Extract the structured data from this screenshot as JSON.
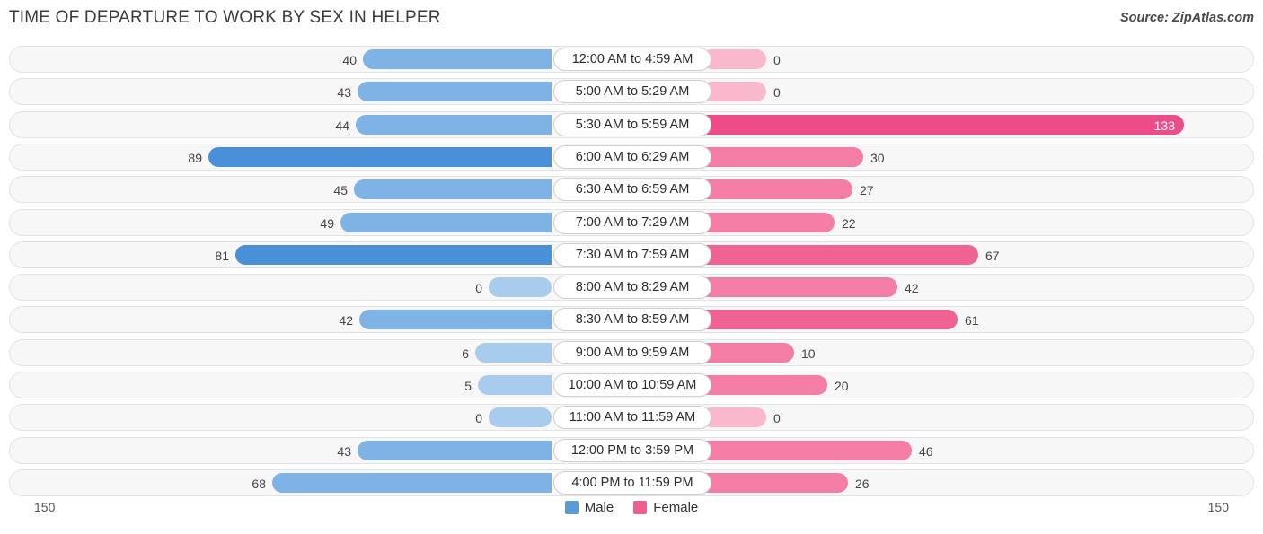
{
  "header": {
    "title": "TIME OF DEPARTURE TO WORK BY SEX IN HELPER",
    "source": "Source: ZipAtlas.com"
  },
  "footer": {
    "axis_left": "150",
    "axis_right": "150",
    "legend": [
      {
        "label": "Male",
        "color": "#5B9BD5"
      },
      {
        "label": "Female",
        "color": "#EC5F8F"
      }
    ]
  },
  "colors": {
    "male_dark": "#4A90D9",
    "male_mid": "#7FB2E5",
    "male_light": "#A8CBEE",
    "female_darkest": "#EC4C87",
    "female_dark": "#F06292",
    "female_mid": "#F47DA6",
    "female_light": "#F9B8CC",
    "track_fill": "#F7F7F7",
    "track_border": "#E3E3E3"
  },
  "chart_data": {
    "type": "bar",
    "title": "TIME OF DEPARTURE TO WORK BY SEX IN HELPER",
    "subtitle": "Source: ZipAtlas.com",
    "orientation": "horizontal",
    "layout": "diverging-bidirectional",
    "xlabel": "",
    "ylabel": "",
    "axis_max": 150,
    "xlim": [
      -150,
      150
    ],
    "grid": false,
    "legend_position": "bottom-center",
    "categories": [
      "12:00 AM to 4:59 AM",
      "5:00 AM to 5:29 AM",
      "5:30 AM to 5:59 AM",
      "6:00 AM to 6:29 AM",
      "6:30 AM to 6:59 AM",
      "7:00 AM to 7:29 AM",
      "7:30 AM to 7:59 AM",
      "8:00 AM to 8:29 AM",
      "8:30 AM to 8:59 AM",
      "9:00 AM to 9:59 AM",
      "10:00 AM to 10:59 AM",
      "11:00 AM to 11:59 AM",
      "12:00 PM to 3:59 PM",
      "4:00 PM to 11:59 PM"
    ],
    "series": [
      {
        "name": "Male",
        "values": [
          40,
          43,
          44,
          89,
          45,
          49,
          81,
          0,
          42,
          6,
          5,
          0,
          43,
          68
        ]
      },
      {
        "name": "Female",
        "values": [
          0,
          0,
          133,
          30,
          27,
          22,
          67,
          42,
          61,
          10,
          20,
          0,
          46,
          26
        ]
      }
    ]
  },
  "rows": [
    {
      "category": "12:00 AM to 4:59 AM",
      "male": "40",
      "female": "0",
      "male_w": 210,
      "female_w": 72,
      "male_color": "#7FB2E5",
      "female_color": "#F9B8CC",
      "male_stub": false,
      "female_stub": true,
      "female_inside": false
    },
    {
      "category": "5:00 AM to 5:29 AM",
      "male": "43",
      "female": "0",
      "male_w": 216,
      "female_w": 72,
      "male_color": "#7FB2E5",
      "female_color": "#F9B8CC",
      "male_stub": false,
      "female_stub": true,
      "female_inside": false
    },
    {
      "category": "5:30 AM to 5:59 AM",
      "male": "44",
      "female": "133",
      "male_w": 218,
      "female_w": 537,
      "male_color": "#7FB2E5",
      "female_color": "#EC4C87",
      "male_stub": false,
      "female_stub": false,
      "female_inside": true
    },
    {
      "category": "6:00 AM to 6:29 AM",
      "male": "89",
      "female": "30",
      "male_w": 382,
      "female_w": 180,
      "male_color": "#4A90D9",
      "female_color": "#F47DA6",
      "male_stub": false,
      "female_stub": false,
      "female_inside": false
    },
    {
      "category": "6:30 AM to 6:59 AM",
      "male": "45",
      "female": "27",
      "male_w": 220,
      "female_w": 168,
      "male_color": "#7FB2E5",
      "female_color": "#F47DA6",
      "male_stub": false,
      "female_stub": false,
      "female_inside": false
    },
    {
      "category": "7:00 AM to 7:29 AM",
      "male": "49",
      "female": "22",
      "male_w": 235,
      "female_w": 148,
      "male_color": "#7FB2E5",
      "female_color": "#F47DA6",
      "male_stub": false,
      "female_stub": false,
      "female_inside": false
    },
    {
      "category": "7:30 AM to 7:59 AM",
      "male": "81",
      "female": "67",
      "male_w": 352,
      "female_w": 308,
      "male_color": "#4A90D9",
      "female_color": "#F06292",
      "male_stub": false,
      "female_stub": false,
      "female_inside": false
    },
    {
      "category": "8:00 AM to 8:29 AM",
      "male": "0",
      "female": "42",
      "male_w": 70,
      "female_w": 218,
      "male_color": "#A8CBEE",
      "female_color": "#F47DA6",
      "male_stub": true,
      "female_stub": false,
      "female_inside": false
    },
    {
      "category": "8:30 AM to 8:59 AM",
      "male": "42",
      "female": "61",
      "male_w": 214,
      "female_w": 285,
      "male_color": "#7FB2E5",
      "female_color": "#F06292",
      "male_stub": false,
      "female_stub": false,
      "female_inside": false
    },
    {
      "category": "9:00 AM to 9:59 AM",
      "male": "6",
      "female": "10",
      "male_w": 85,
      "female_w": 103,
      "male_color": "#A8CBEE",
      "female_color": "#F47DA6",
      "male_stub": false,
      "female_stub": false,
      "female_inside": false
    },
    {
      "category": "10:00 AM to 10:59 AM",
      "male": "5",
      "female": "20",
      "male_w": 82,
      "female_w": 140,
      "male_color": "#A8CBEE",
      "female_color": "#F47DA6",
      "male_stub": false,
      "female_stub": false,
      "female_inside": false
    },
    {
      "category": "11:00 AM to 11:59 AM",
      "male": "0",
      "female": "0",
      "male_w": 70,
      "female_w": 72,
      "male_color": "#A8CBEE",
      "female_color": "#F9B8CC",
      "male_stub": true,
      "female_stub": true,
      "female_inside": false
    },
    {
      "category": "12:00 PM to 3:59 PM",
      "male": "43",
      "female": "46",
      "male_w": 216,
      "female_w": 234,
      "male_color": "#7FB2E5",
      "female_color": "#F47DA6",
      "male_stub": false,
      "female_stub": false,
      "female_inside": false
    },
    {
      "category": "4:00 PM to 11:59 PM",
      "male": "68",
      "female": "26",
      "male_w": 311,
      "female_w": 163,
      "male_color": "#7FB2E5",
      "female_color": "#F47DA6",
      "male_stub": false,
      "female_stub": false,
      "female_inside": false
    }
  ]
}
